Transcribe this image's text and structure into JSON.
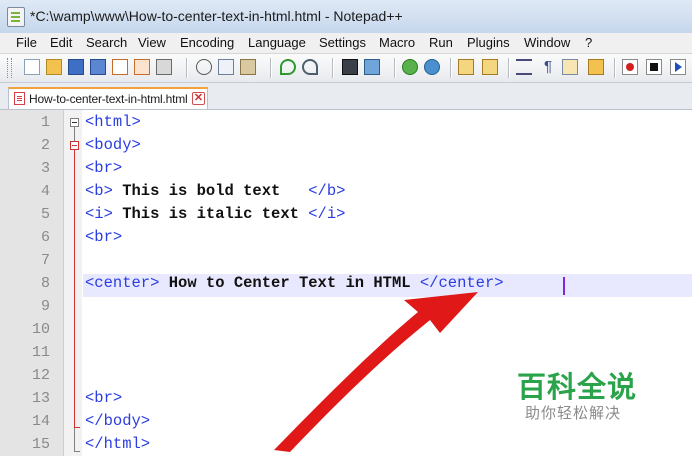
{
  "window": {
    "title": "*C:\\wamp\\www\\How-to-center-text-in-html.html - Notepad++"
  },
  "menu": [
    "File",
    "Edit",
    "Search",
    "View",
    "Encoding",
    "Language",
    "Settings",
    "Macro",
    "Run",
    "Plugins",
    "Window",
    "?"
  ],
  "tab": {
    "label": "How-to-center-text-in-html.html",
    "close": "✕"
  },
  "editor": {
    "line_numbers": [
      "1",
      "2",
      "3",
      "4",
      "5",
      "6",
      "7",
      "8",
      "9",
      "10",
      "11",
      "12",
      "13",
      "14",
      "15"
    ],
    "lines": {
      "l1_tag": "<html>",
      "l2_tag": "<body>",
      "l3_tag": "<br>",
      "l4_open": "<b>",
      "l4_text": " This is bold text   ",
      "l4_close": "</b>",
      "l5_open": "<i>",
      "l5_text": " This is italic text ",
      "l5_close": "</i>",
      "l6_tag": "<br>",
      "l8_open": "<center>",
      "l8_text": " How to Center Text in HTML ",
      "l8_close": "</center>",
      "l13_tag": "<br>",
      "l14_tag": "</body>",
      "l15_tag": "</html>"
    }
  },
  "watermark": {
    "main": "百科全说",
    "sub": "助你轻松解决"
  },
  "colors": {
    "tag": "#2a3ee0",
    "highlight": "#e8e8ff",
    "arrow": "#e01818",
    "watermark": "#2aa34a"
  },
  "icons": [
    "new-file-icon",
    "open-file-icon",
    "save-icon",
    "save-all-icon",
    "close-icon",
    "close-all-icon",
    "print-icon",
    "cut-icon",
    "copy-icon",
    "paste-icon",
    "undo-icon",
    "redo-icon",
    "find-icon",
    "replace-icon",
    "zoom-in-icon",
    "zoom-out-icon",
    "sync-v-icon",
    "sync-h-icon",
    "word-wrap-icon",
    "show-all-chars-icon",
    "indent-guide-icon",
    "udl-icon",
    "record-macro-icon",
    "stop-macro-icon",
    "play-macro-icon"
  ]
}
